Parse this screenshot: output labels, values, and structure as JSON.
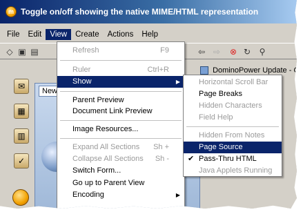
{
  "window": {
    "title": "Toggle on/off showing the native MIME/HTML representation",
    "app_icon_glyph": "m"
  },
  "menubar": [
    "File",
    "Edit",
    "View",
    "Create",
    "Actions",
    "Help"
  ],
  "doc_tab": "DominoPower Update - Get",
  "pane_tab": "New",
  "view_menu": {
    "items": [
      {
        "label": "Refresh",
        "shortcut": "F9",
        "disabled": true
      },
      {
        "label": "Ruler",
        "shortcut": "Ctrl+R",
        "disabled": true
      },
      {
        "label": "Show",
        "submenu": true,
        "highlighted": true
      },
      {
        "label": "Parent Preview"
      },
      {
        "label": "Document Link Preview"
      },
      {
        "label": "Image Resources..."
      },
      {
        "label": "Expand All Sections",
        "shortcut": "Sh +",
        "disabled": true
      },
      {
        "label": "Collapse All Sections",
        "shortcut": "Sh -",
        "disabled": true
      },
      {
        "label": "Switch Form..."
      },
      {
        "label": "Go up to Parent View"
      },
      {
        "label": "Encoding",
        "submenu": true
      }
    ]
  },
  "show_menu": {
    "items": [
      {
        "label": "Horizontal Scroll Bar",
        "disabled": true
      },
      {
        "label": "Page Breaks"
      },
      {
        "label": "Hidden Characters",
        "disabled": true
      },
      {
        "label": "Field Help",
        "disabled": true
      },
      {
        "label": "Hidden From Notes",
        "disabled": true
      },
      {
        "label": "Page Source",
        "highlighted": true
      },
      {
        "label": "Pass-Thru HTML",
        "checked": true
      },
      {
        "label": "Java Applets Running",
        "disabled": true
      }
    ]
  },
  "colors": {
    "highlight": "#0a246a",
    "menu_bg": "#ffffff",
    "disabled_text": "#9a9a9a",
    "chrome": "#d4d0c8"
  }
}
